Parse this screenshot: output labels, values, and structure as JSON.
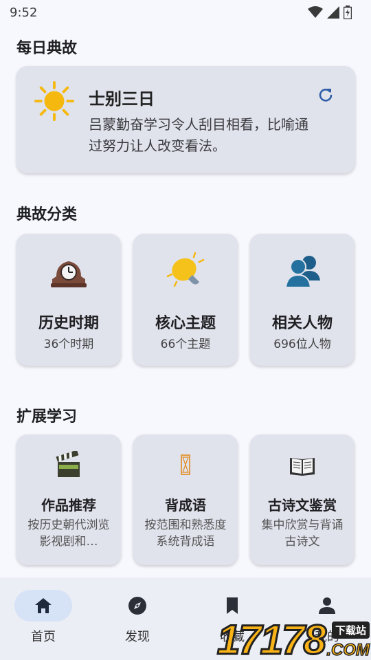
{
  "status": {
    "time": "9:52"
  },
  "daily": {
    "section_title": "每日典故",
    "title": "士别三日",
    "description": "吕蒙勤奋学习令人刮目相看，比喻通过努力让人改变看法。",
    "icon": "sun-icon"
  },
  "categories": {
    "section_title": "典故分类",
    "items": [
      {
        "title": "历史时期",
        "subtitle": "36个时期",
        "icon": "mantel-clock-icon"
      },
      {
        "title": "核心主题",
        "subtitle": "66个主题",
        "icon": "lightbulb-icon"
      },
      {
        "title": "相关人物",
        "subtitle": "696位人物",
        "icon": "people-icon"
      }
    ]
  },
  "extended": {
    "section_title": "扩展学习",
    "items": [
      {
        "title": "作品推荐",
        "description": "按历史朝代浏览影视剧和…",
        "icon": "clapperboard-icon"
      },
      {
        "title": "背成语",
        "description": "按范围和熟悉度系统背成语",
        "icon": "hourglass-icon"
      },
      {
        "title": "古诗文鉴赏",
        "description": "集中欣赏与背诵古诗文",
        "icon": "open-book-icon"
      }
    ]
  },
  "nav": {
    "items": [
      {
        "label": "首页",
        "icon": "home-icon",
        "active": true
      },
      {
        "label": "发现",
        "icon": "compass-icon",
        "active": false
      },
      {
        "label": "收藏",
        "icon": "bookmark-icon",
        "active": false
      },
      {
        "label": "我的",
        "icon": "person-icon",
        "active": false
      }
    ]
  },
  "watermark": {
    "number": "17178",
    "tag": "下载站",
    "domain": ".COM"
  },
  "colors": {
    "accent": "#2f5fa7",
    "card": "#e0e2ec",
    "background": "#f7f8fd",
    "nav_active": "#d6e2f6"
  }
}
